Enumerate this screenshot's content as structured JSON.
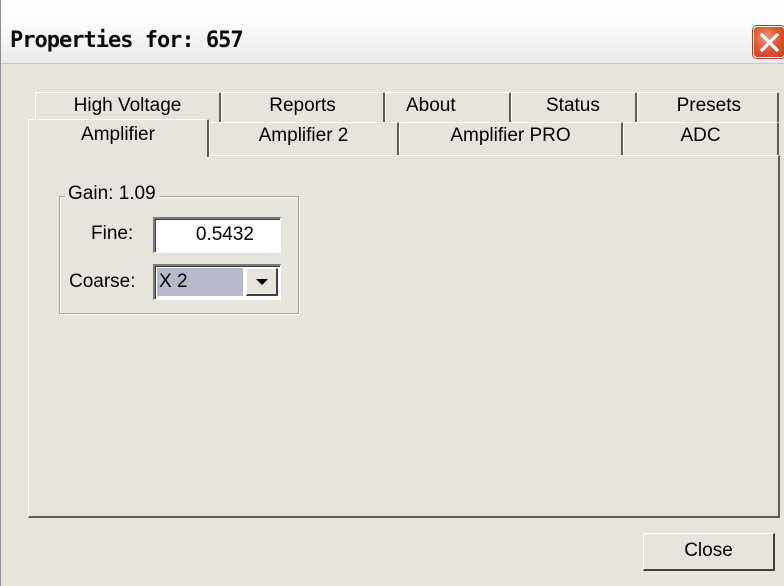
{
  "window": {
    "title": "Properties for: 657"
  },
  "tabs": {
    "row_back": [
      {
        "label": "High Voltage"
      },
      {
        "label": "Reports"
      },
      {
        "label": "About"
      },
      {
        "label": "Status"
      },
      {
        "label": "Presets"
      }
    ],
    "row_front": [
      {
        "label": "Amplifier",
        "active": true
      },
      {
        "label": "Amplifier 2"
      },
      {
        "label": "Amplifier PRO"
      },
      {
        "label": "ADC"
      }
    ]
  },
  "gain": {
    "legend": "Gain: 1.09",
    "fine_label": "Fine:",
    "fine_value": "0.5432",
    "coarse_label": "Coarse:",
    "coarse_value": "X 2"
  },
  "footer": {
    "close_label": "Close"
  },
  "icons": {
    "close": "close-icon",
    "dropdown": "chevron-down-icon"
  },
  "colors": {
    "window_bg": "#e7e4dc",
    "close_button_red": "#e0593a",
    "selection_bg": "#b6b9c9"
  }
}
